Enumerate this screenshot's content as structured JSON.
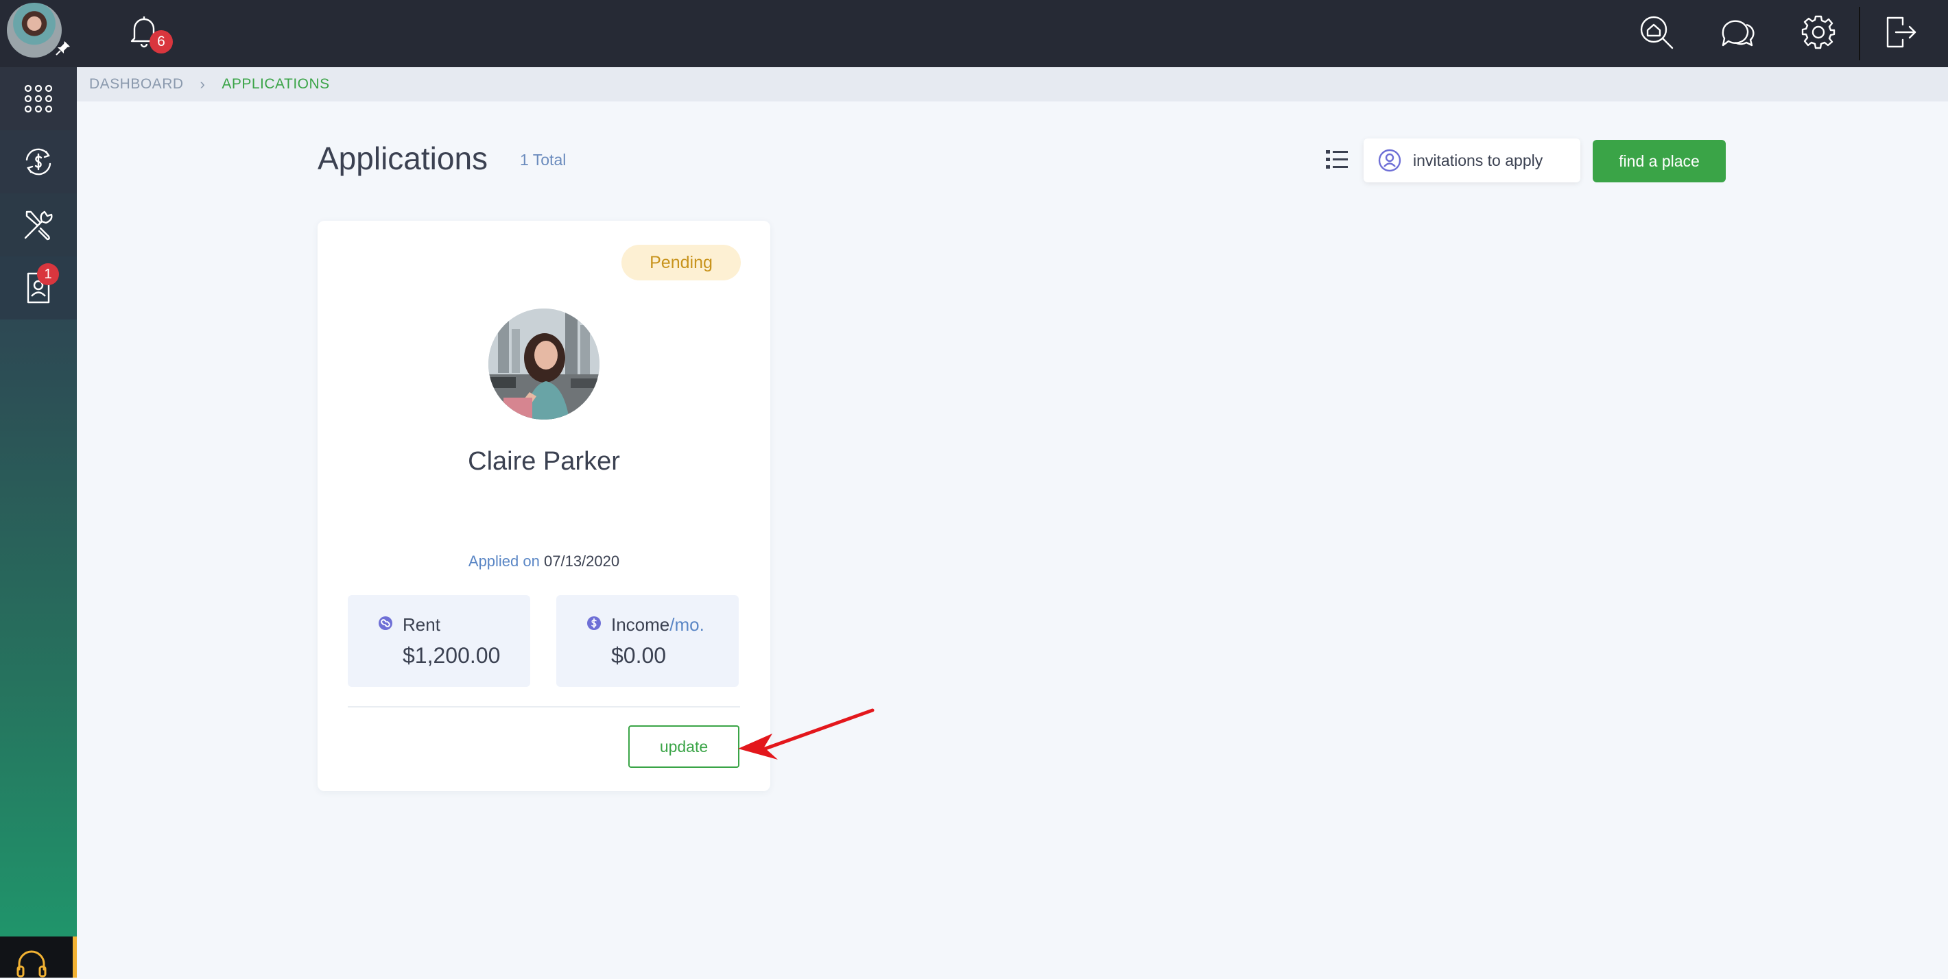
{
  "topbar": {
    "notifications_count": "6"
  },
  "sidebar": {
    "items": [
      {
        "name": "apps-grid-icon"
      },
      {
        "name": "payments-cycle-icon"
      },
      {
        "name": "tools-icon"
      },
      {
        "name": "tenant-contact-icon",
        "badge": "1"
      }
    ]
  },
  "breadcrumb": {
    "root": "DASHBOARD",
    "separator": "›",
    "current": "APPLICATIONS"
  },
  "header": {
    "title": "Applications",
    "total": "1 Total",
    "invite_label": "invitations to apply",
    "find_label": "find a place"
  },
  "application": {
    "status": "Pending",
    "name": "Claire Parker",
    "applied_label": "Applied on",
    "applied_date": "07/13/2020",
    "rent_label": "Rent",
    "rent_value": "$1,200.00",
    "income_label": "Income",
    "income_unit": "/mo.",
    "income_value": "$0.00",
    "update_label": "update"
  },
  "colors": {
    "accent": "#3aa447",
    "badge": "#d9363e",
    "pending_bg": "#fdf0d3",
    "pending_text": "#c8931c"
  }
}
